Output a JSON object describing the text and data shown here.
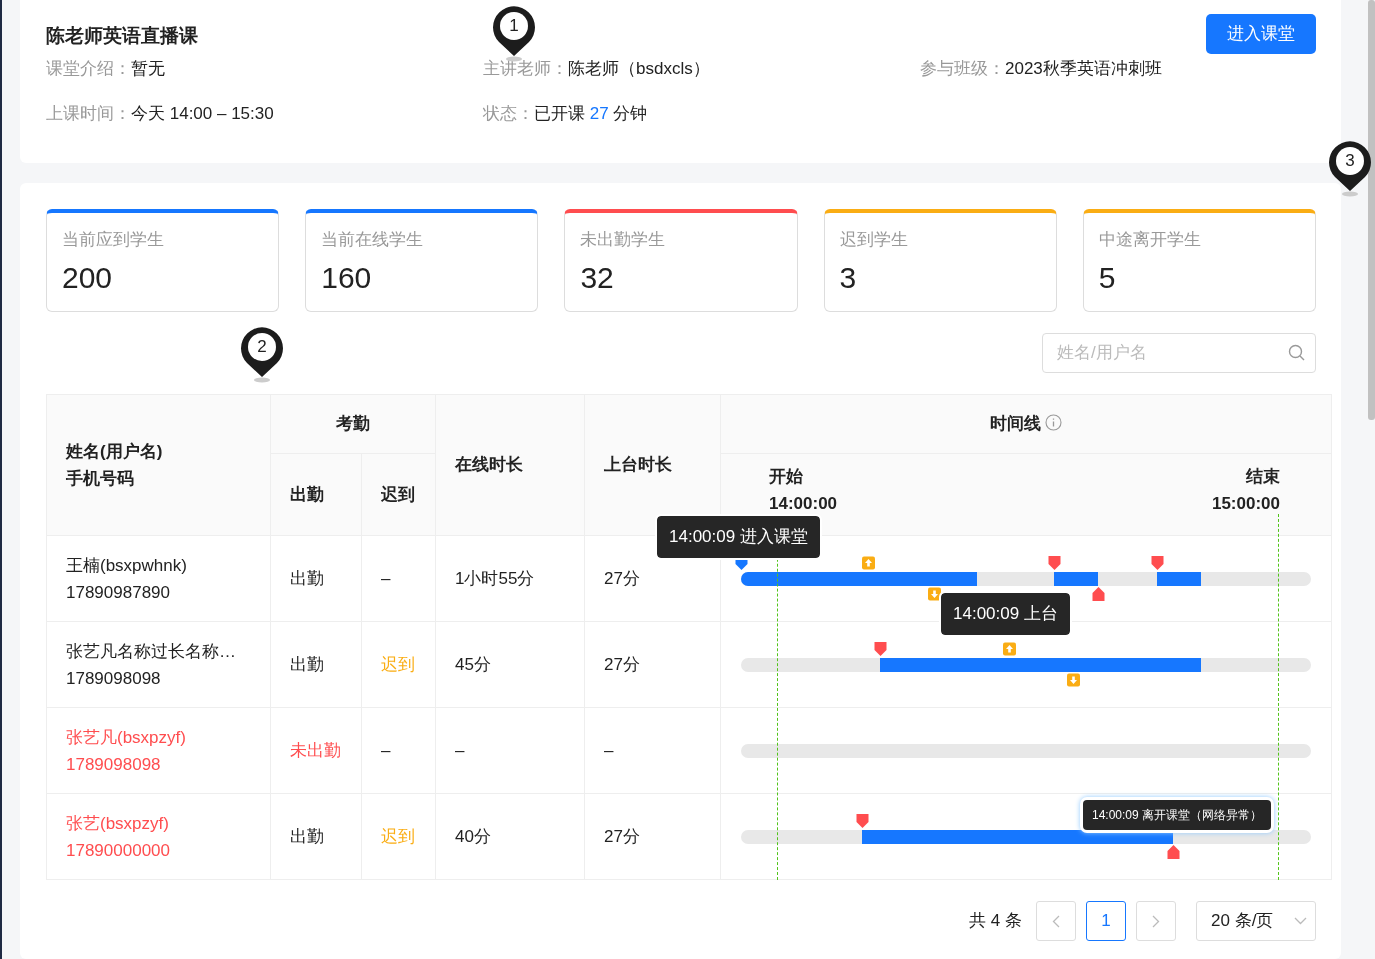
{
  "course": {
    "title": "陈老师英语直播课",
    "enter_button": "进入课堂",
    "info": [
      {
        "label": "课堂介绍：",
        "value": "暂无"
      },
      {
        "label": "主讲老师：",
        "value": "陈老师（bsdxcls）"
      },
      {
        "label": "参与班级：",
        "value": "2023秋季英语冲刺班"
      },
      {
        "label": "上课时间：",
        "value": "今天 14:00 – 15:30"
      },
      {
        "label": "状态：",
        "value": "已开课",
        "highlight": "27",
        "unit": "分钟"
      }
    ]
  },
  "stats": [
    {
      "label": "当前应到学生",
      "value": "200",
      "color": "#1677ff"
    },
    {
      "label": "当前在线学生",
      "value": "160",
      "color": "#1677ff"
    },
    {
      "label": "未出勤学生",
      "value": "32",
      "color": "#ff4d4f"
    },
    {
      "label": "迟到学生",
      "value": "3",
      "color": "#faad14"
    },
    {
      "label": "中途离开学生",
      "value": "5",
      "color": "#faad14"
    }
  ],
  "search": {
    "placeholder": "姓名/用户名"
  },
  "table": {
    "columns": {
      "name": [
        "姓名(用户名)",
        "手机号码"
      ],
      "attendance_group": "考勤",
      "present": "出勤",
      "late": "迟到",
      "online": "在线时长",
      "stage": "上台时长",
      "timeline": "时间线",
      "start": [
        "开始",
        "14:00:00"
      ],
      "end": [
        "结束",
        "15:00:00"
      ]
    },
    "rows": [
      {
        "name": "王楠(bsxpwhnk)",
        "phone": "17890987890",
        "alert": false,
        "attendance": "出勤",
        "absent": false,
        "late": "–",
        "is_late": false,
        "online": "1小时55分",
        "stage": "27分"
      },
      {
        "name": "张艺凡名称过长名称…",
        "phone": "1789098098",
        "alert": false,
        "attendance": "出勤",
        "absent": false,
        "late": "迟到",
        "is_late": true,
        "online": "45分",
        "stage": "27分"
      },
      {
        "name": "张艺凡(bsxpzyf)",
        "phone": "1789098098",
        "alert": true,
        "attendance": "未出勤",
        "absent": true,
        "late": "–",
        "is_late": false,
        "online": "–",
        "stage": "–"
      },
      {
        "name": "张艺(bsxpzyf)",
        "phone": "17890000000",
        "alert": true,
        "attendance": "出勤",
        "absent": false,
        "late": "迟到",
        "is_late": true,
        "online": "40分",
        "stage": "27分"
      }
    ],
    "tooltips": [
      {
        "text": "14:00:09 进入课堂"
      },
      {
        "text": "14:00:09 上台"
      },
      {
        "text": "14:00:09 离开课堂（网络异常）"
      }
    ]
  },
  "pagination": {
    "total": "共 4 条",
    "pages": [
      {
        "label": "1",
        "selected": true
      }
    ],
    "page_size": "20 条/页"
  },
  "markers": [
    {
      "label": "1"
    },
    {
      "label": "2"
    },
    {
      "label": "3"
    }
  ]
}
